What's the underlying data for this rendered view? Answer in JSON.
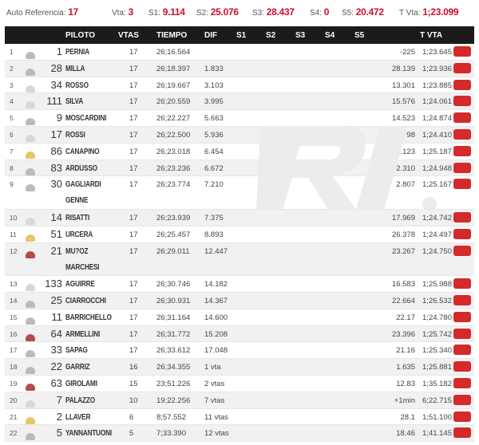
{
  "topbar": {
    "auto_label": "Auto Referencia:",
    "auto_value": "17",
    "vta_label": "Vta:",
    "vta_value": "3",
    "s1_label": "S1:",
    "s1_value": "9.114",
    "s2_label": "S2:",
    "s2_value": "25.076",
    "s3_label": "S3:",
    "s3_value": "28.437",
    "s4_label": "S4:",
    "s4_value": "0",
    "s5_label": "S5:",
    "s5_value": "20.472",
    "tvta_label": "T Vta:",
    "tvta_value": "1;23.099"
  },
  "headers": {
    "piloto": "PILOTO",
    "vtas": "VTAS",
    "tiempo": "TIEMPO",
    "dif": "DIF",
    "s1": "S1",
    "s2": "S2",
    "s3": "S3",
    "s4": "S4",
    "s5": "S5",
    "tvta": "T VTA"
  },
  "rows": [
    {
      "pos": "1",
      "num": "1",
      "name": "PERNIA",
      "vtas": "17",
      "tiempo": "26;16.564",
      "dif": "",
      "s5": "-225",
      "tvta": "1;23.645",
      "icon": "grey"
    },
    {
      "pos": "2",
      "num": "28",
      "name": "MILLA",
      "vtas": "17",
      "tiempo": "26;18.397",
      "dif": "1.833",
      "s5": "28.139",
      "tvta": "1;23.936",
      "icon": "grey"
    },
    {
      "pos": "3",
      "num": "34",
      "name": "ROSSO",
      "vtas": "17",
      "tiempo": "26;19.667",
      "dif": "3.103",
      "s5": "13.301",
      "tvta": "1;23.885",
      "icon": "light"
    },
    {
      "pos": "4",
      "num": "111",
      "name": "SILVA",
      "vtas": "17",
      "tiempo": "26;20.559",
      "dif": "3.995",
      "s5": "15.576",
      "tvta": "1;24.061",
      "icon": "light"
    },
    {
      "pos": "5",
      "num": "9",
      "name": "MOSCARDINI",
      "vtas": "17",
      "tiempo": "26;22.227",
      "dif": "5.663",
      "s5": "14.523",
      "tvta": "1;24.874",
      "icon": "grey"
    },
    {
      "pos": "6",
      "num": "17",
      "name": "ROSSI",
      "vtas": "17",
      "tiempo": "26;22.500",
      "dif": "5.936",
      "s5": "11.798",
      "tvta": "1;24.410",
      "icon": "light"
    },
    {
      "pos": "7",
      "num": "86",
      "name": "CANAPINO",
      "vtas": "17",
      "tiempo": "26;23.018",
      "dif": "6.454",
      "s5": "12.123",
      "tvta": "1;25.187",
      "icon": "gold"
    },
    {
      "pos": "8",
      "num": "83",
      "name": "ARDUSSO",
      "vtas": "17",
      "tiempo": "26;23.236",
      "dif": "6.672",
      "s5": "2.310",
      "tvta": "1;24.948",
      "icon": "grey"
    },
    {
      "pos": "9",
      "num": "30",
      "name": "GAGLIARDI GENNE",
      "vtas": "17",
      "tiempo": "26;23.774",
      "dif": "7.210",
      "s5": "2.807",
      "tvta": "1;25.167",
      "icon": "grey",
      "tall": true
    },
    {
      "pos": "10",
      "num": "14",
      "name": "RISATTI",
      "vtas": "17",
      "tiempo": "26;23.939",
      "dif": "7.375",
      "s5": "17.969",
      "tvta": "1;24.742",
      "icon": "light"
    },
    {
      "pos": "11",
      "num": "51",
      "name": "URCERA",
      "vtas": "17",
      "tiempo": "26;25.457",
      "dif": "8.893",
      "s5": "26.378",
      "tvta": "1;24.497",
      "icon": "gold"
    },
    {
      "pos": "12",
      "num": "21",
      "name": "MU?OZ MARCHESI",
      "vtas": "17",
      "tiempo": "26;29.011",
      "dif": "12.447",
      "s5": "23.267",
      "tvta": "1;24.750",
      "icon": "red",
      "tall": true
    },
    {
      "pos": "13",
      "num": "133",
      "name": "AGUIRRE",
      "vtas": "17",
      "tiempo": "26;30.746",
      "dif": "14.182",
      "s5": "16.583",
      "tvta": "1;25.988",
      "icon": "light"
    },
    {
      "pos": "14",
      "num": "25",
      "name": "CIARROCCHI",
      "vtas": "17",
      "tiempo": "26;30.931",
      "dif": "14.367",
      "s5": "22.664",
      "tvta": "1;26.532",
      "icon": "grey"
    },
    {
      "pos": "15",
      "num": "11",
      "name": "BARRICHELLO",
      "vtas": "17",
      "tiempo": "26;31.164",
      "dif": "14.600",
      "s5": "22.17",
      "tvta": "1;24.780",
      "icon": "grey"
    },
    {
      "pos": "16",
      "num": "64",
      "name": "ARMELLINI",
      "vtas": "17",
      "tiempo": "26;31.772",
      "dif": "15.208",
      "s5": "23.396",
      "tvta": "1;25.742",
      "icon": "red"
    },
    {
      "pos": "17",
      "num": "33",
      "name": "SAPAG",
      "vtas": "17",
      "tiempo": "26;33.612",
      "dif": "17.048",
      "s5": "21.16",
      "tvta": "1;25.340",
      "icon": "grey"
    },
    {
      "pos": "18",
      "num": "22",
      "name": "GARRIZ",
      "vtas": "16",
      "tiempo": "26;34.355",
      "dif": "1 vta",
      "s5": "1.635",
      "tvta": "1;25.881",
      "icon": "grey"
    },
    {
      "pos": "19",
      "num": "63",
      "name": "GIROLAMI",
      "vtas": "15",
      "tiempo": "23;51.226",
      "dif": "2 vtas",
      "s5": "12.83",
      "tvta": "1;35.182",
      "icon": "red"
    },
    {
      "pos": "20",
      "num": "7",
      "name": "PALAZZO",
      "vtas": "10",
      "tiempo": "19;22.256",
      "dif": "7 vtas",
      "s5": "+1min",
      "tvta": "6;22.715",
      "icon": "light"
    },
    {
      "pos": "21",
      "num": "2",
      "name": "LLAVER",
      "vtas": "6",
      "tiempo": "8;57.552",
      "dif": "11 vtas",
      "s5": "28.1",
      "tvta": "1;51.100",
      "icon": "gold"
    },
    {
      "pos": "22",
      "num": "5",
      "name": "YANNANTUONI",
      "vtas": "5",
      "tiempo": "7;33.390",
      "dif": "12 vtas",
      "s5": "18.46",
      "tvta": "1;41.145",
      "icon": "grey"
    }
  ],
  "colors": {
    "header_bg": "#1b1b1b",
    "accent": "#c8102e",
    "button": "#d42a2a",
    "alt_row": "#f1f1f1"
  }
}
